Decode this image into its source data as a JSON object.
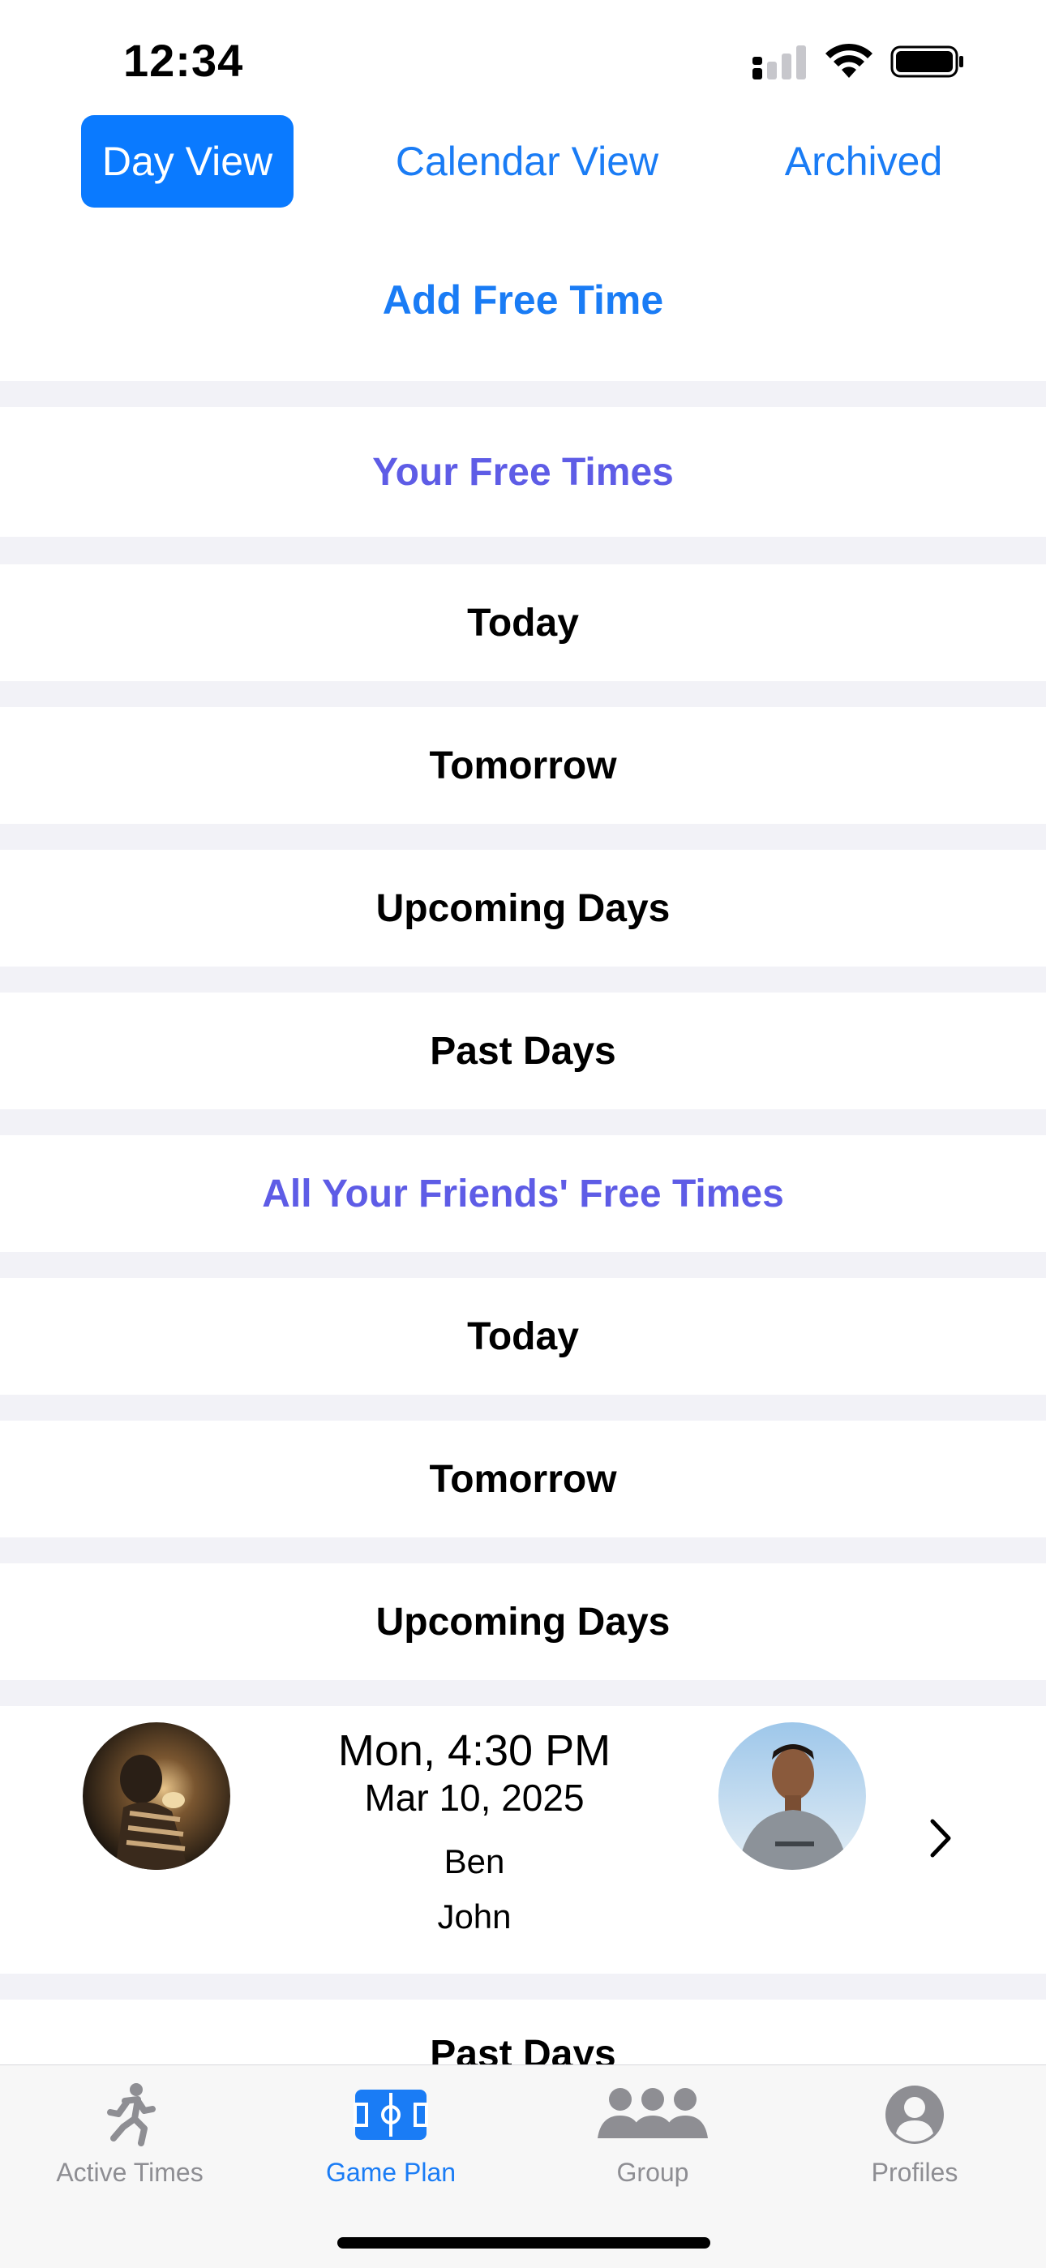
{
  "status": {
    "time": "12:34"
  },
  "segments": [
    {
      "label": "Day View",
      "active": true
    },
    {
      "label": "Calendar View",
      "active": false
    },
    {
      "label": "Archived",
      "active": false
    }
  ],
  "add_free_time": "Add Free Time",
  "your_section": {
    "title": "Your Free Times",
    "rows": [
      "Today",
      "Tomorrow",
      "Upcoming Days",
      "Past Days"
    ]
  },
  "friends_section": {
    "title": "All Your Friends' Free Times",
    "rows": [
      "Today",
      "Tomorrow",
      "Upcoming Days",
      "Past Days"
    ]
  },
  "slot": {
    "day_time": "Mon, 4:30 PM",
    "date": "Mar 10, 2025",
    "participants": [
      "Ben",
      "John"
    ]
  },
  "tabs": [
    {
      "label": "Active Times",
      "icon": "running-figure-icon",
      "active": false
    },
    {
      "label": "Game Plan",
      "icon": "soccer-field-icon",
      "active": true
    },
    {
      "label": "Group",
      "icon": "people-group-icon",
      "active": false
    },
    {
      "label": "Profiles",
      "icon": "person-circle-icon",
      "active": false
    }
  ],
  "colors": {
    "accent": "#1a7cf5",
    "section": "#5e5ce6",
    "background": "#f2f2f7"
  }
}
